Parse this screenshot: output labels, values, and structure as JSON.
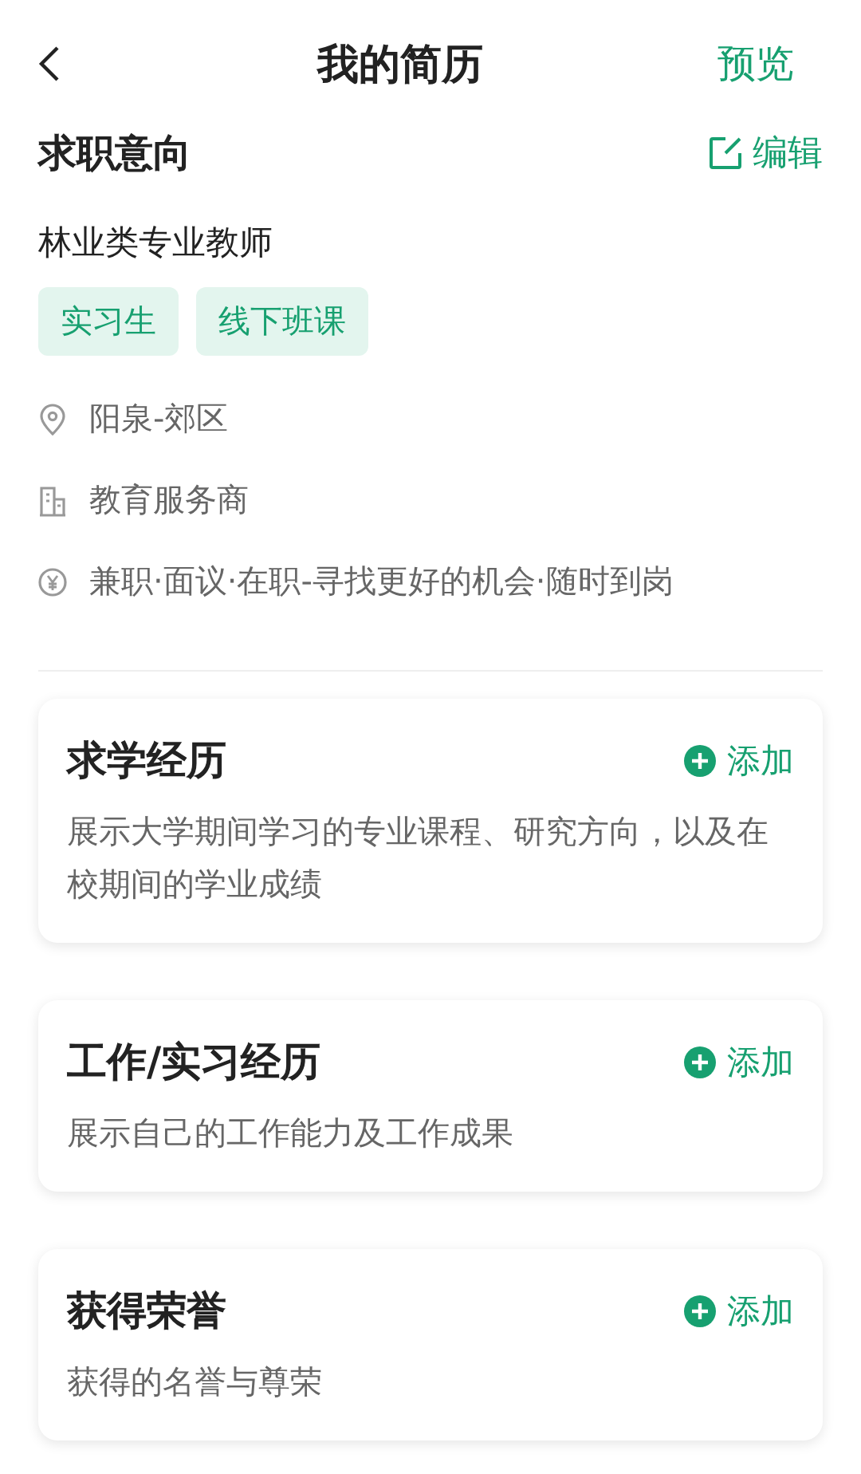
{
  "header": {
    "title": "我的简历",
    "action": "预览"
  },
  "intention": {
    "title": "求职意向",
    "edit": "编辑",
    "job": "林业类专业教师",
    "tags": [
      "实习生",
      "线下班课"
    ],
    "details": [
      {
        "kind": "location",
        "text": "阳泉-郊区"
      },
      {
        "kind": "industry",
        "text": "教育服务商"
      },
      {
        "kind": "salary",
        "text": "兼职·面议·在职-寻找更好的机会·随时到岗"
      }
    ]
  },
  "sections": [
    {
      "title": "求学经历",
      "add": "添加",
      "description": "展示大学期间学习的专业课程、研究方向，以及在校期间的学业成绩"
    },
    {
      "title": "工作/实习经历",
      "add": "添加",
      "description": "展示自己的工作能力及工作成果"
    },
    {
      "title": "获得荣誉",
      "add": "添加",
      "description": "获得的名誉与尊荣"
    }
  ]
}
